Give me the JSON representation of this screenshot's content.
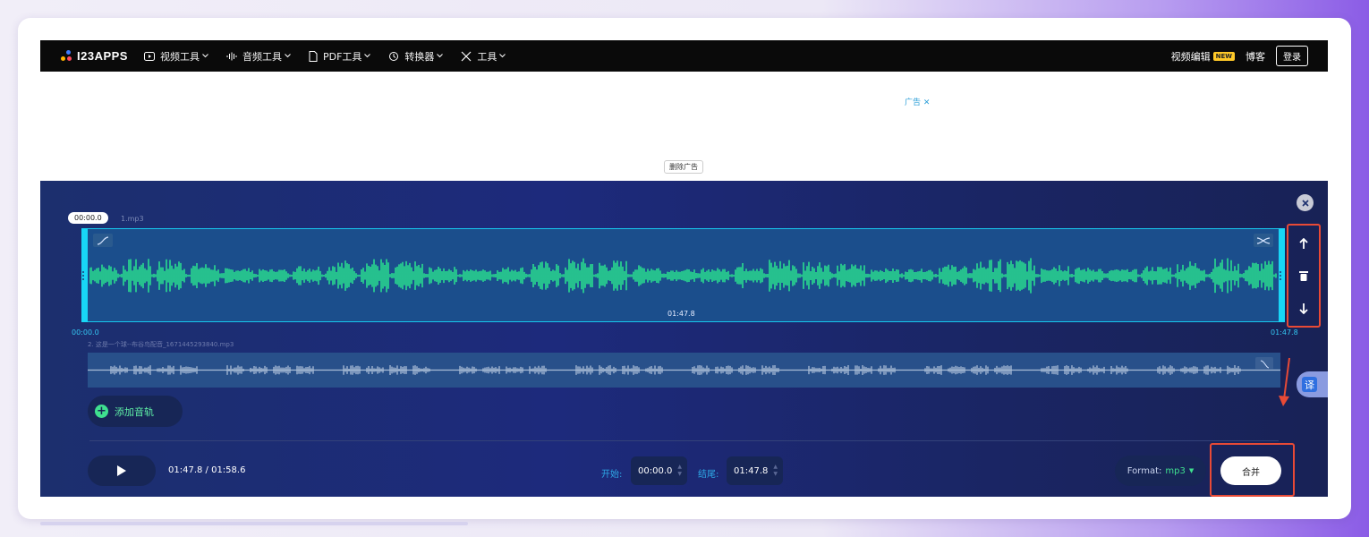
{
  "navbar": {
    "logo_text": "I23APPS",
    "items": [
      {
        "label": "视频工具",
        "icon": "video-icon"
      },
      {
        "label": "音频工具",
        "icon": "audio-wave-icon"
      },
      {
        "label": "PDF工具",
        "icon": "document-icon"
      },
      {
        "label": "转换器",
        "icon": "convert-icon"
      },
      {
        "label": "工具",
        "icon": "tools-icon"
      }
    ],
    "video_editor_label": "视频编辑",
    "new_badge": "NEW",
    "blog_label": "博客",
    "login_label": "登录"
  },
  "ad": {
    "label": "广告",
    "close_icon": "close-icon",
    "remove_ad_label": "删除广告"
  },
  "editor": {
    "cursor_time": "00:00.0",
    "track1": {
      "name": "1.mp3",
      "duration": "01:47.8",
      "start_label": "00:00.0",
      "end_label": "01:47.8",
      "wave_color": "#2cf28f"
    },
    "track2": {
      "name": "2. 这是一个球--布谷鸟配音_1671445293840.mp3",
      "wave_color": "#a9bcd6"
    },
    "add_track_label": "添加音轨",
    "translate_label": "译",
    "playback_time": "01:47.8 / 01:58.6",
    "start_label": "开始:",
    "start_value": "00:00.0",
    "end_label": "结尾:",
    "end_value": "01:47.8",
    "format_label": "Format:",
    "format_value": "mp3",
    "merge_label": "合并"
  },
  "colors": {
    "navbar_bg": "#0a0a0a",
    "editor_bg": "#1c2f6e",
    "selection": "#18d6f6",
    "highlight_red": "#e84a36"
  }
}
